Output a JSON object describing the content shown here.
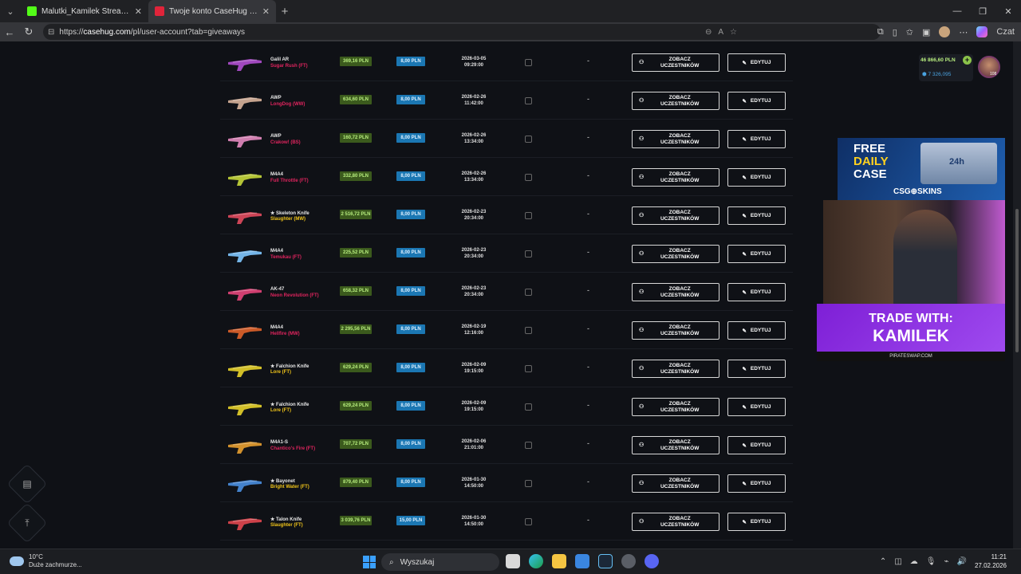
{
  "browser": {
    "tabs": [
      {
        "title": "Malutki_Kamilek Stream - Watch Li",
        "active": false,
        "favicon_color": "#53fc18"
      },
      {
        "title": "Twoje konto CaseHug – Ekwipunek",
        "active": true,
        "favicon_color": "#e0243a"
      }
    ],
    "url_prefix": "https://",
    "url_host": "casehug.com",
    "url_path": "/pl/user-account?tab=giveaways",
    "copilot_label": "Czat"
  },
  "giveaways": {
    "view_label": "ZOBACZ UCZESTNIKÓW",
    "edit_label": "EDYTUJ",
    "rows": [
      {
        "weapon": "Galil AR",
        "skin": "Sugar Rush (FT)",
        "skin_color": "#e0245e",
        "price": "369,16 PLN",
        "fee": "8,00 PLN",
        "date": "2026-03-05",
        "time": "09:29:00",
        "winner": "-",
        "img_color": "#b04fd0"
      },
      {
        "weapon": "AWP",
        "skin": "LongDog (WW)",
        "skin_color": "#e0245e",
        "price": "634,60 PLN",
        "fee": "8,00 PLN",
        "date": "2026-02-26",
        "time": "11:42:00",
        "winner": "-",
        "img_color": "#d9b49b"
      },
      {
        "weapon": "AWP",
        "skin": "Crakow! (BS)",
        "skin_color": "#e0245e",
        "price": "160,72 PLN",
        "fee": "8,00 PLN",
        "date": "2026-02-26",
        "time": "13:34:00",
        "winner": "-",
        "img_color": "#e58bc0"
      },
      {
        "weapon": "M4A4",
        "skin": "Full Throttle (FT)",
        "skin_color": "#e0245e",
        "price": "332,80 PLN",
        "fee": "8,00 PLN",
        "date": "2026-02-26",
        "time": "13:34:00",
        "winner": "-",
        "img_color": "#c6d83a"
      },
      {
        "weapon": "★ Skeleton Knife",
        "skin": "Slaughter (MW)",
        "skin_color": "#f0c419",
        "price": "2 516,72 PLN",
        "fee": "8,00 PLN",
        "date": "2026-02-23",
        "time": "20:34:00",
        "winner": "-",
        "img_color": "#e24b5e"
      },
      {
        "weapon": "M4A4",
        "skin": "Temukau (FT)",
        "skin_color": "#e0245e",
        "price": "225,52 PLN",
        "fee": "8,00 PLN",
        "date": "2026-02-23",
        "time": "20:34:00",
        "winner": "-",
        "img_color": "#7fc8ff"
      },
      {
        "weapon": "AK-47",
        "skin": "Neon Revolution (FT)",
        "skin_color": "#e0245e",
        "price": "658,32 PLN",
        "fee": "8,00 PLN",
        "date": "2026-02-23",
        "time": "20:34:00",
        "winner": "-",
        "img_color": "#e6457a"
      },
      {
        "weapon": "M4A4",
        "skin": "Hellfire (MW)",
        "skin_color": "#e0245e",
        "price": "2 295,56 PLN",
        "fee": "8,00 PLN",
        "date": "2026-02-19",
        "time": "12:16:00",
        "winner": "-",
        "img_color": "#e0632a"
      },
      {
        "weapon": "★ Falchion Knife",
        "skin": "Lore (FT)",
        "skin_color": "#f0c419",
        "price": "629,24 PLN",
        "fee": "8,00 PLN",
        "date": "2026-02-09",
        "time": "19:15:00",
        "winner": "-",
        "img_color": "#e8d32a"
      },
      {
        "weapon": "★ Falchion Knife",
        "skin": "Lore (FT)",
        "skin_color": "#f0c419",
        "price": "629,24 PLN",
        "fee": "8,00 PLN",
        "date": "2026-02-09",
        "time": "19:15:00",
        "winner": "-",
        "img_color": "#e8d32a"
      },
      {
        "weapon": "M4A1-S",
        "skin": "Chantico's Fire (FT)",
        "skin_color": "#e0245e",
        "price": "707,72 PLN",
        "fee": "8,00 PLN",
        "date": "2026-02-06",
        "time": "21:01:00",
        "winner": "-",
        "img_color": "#e8a030"
      },
      {
        "weapon": "★ Bayonet",
        "skin": "Bright Water (FT)",
        "skin_color": "#f0c419",
        "price": "879,40 PLN",
        "fee": "8,00 PLN",
        "date": "2026-01-30",
        "time": "14:50:00",
        "winner": "-",
        "img_color": "#4a8fe0"
      },
      {
        "weapon": "★ Talon Knife",
        "skin": "Slaughter (FT)",
        "skin_color": "#f0c419",
        "price": "3 039,76 PLN",
        "fee": "15,00 PLN",
        "date": "2026-01-30",
        "time": "14:50:00",
        "winner": "-",
        "img_color": "#e2474f"
      }
    ]
  },
  "user": {
    "balance_pln": "46 866,60 PLN",
    "coins": "7 326,095",
    "level": "108"
  },
  "ads": {
    "ad1_line1": "FREE",
    "ad1_line2": "DAILY",
    "ad1_line3": "CASE",
    "ad1_brand": "CSG⊕SKINS",
    "ad1_chest_label": "24h",
    "ad2_line1": "TRADE WITH:",
    "ad2_line2": "KAMILEK",
    "ad2_site": "PIRATESWAP.COM"
  },
  "taskbar": {
    "weather_temp": "10°C",
    "weather_desc": "Duże zachmurze...",
    "search_placeholder": "Wyszukaj",
    "time": "11:21",
    "date": "27.02.2026"
  }
}
